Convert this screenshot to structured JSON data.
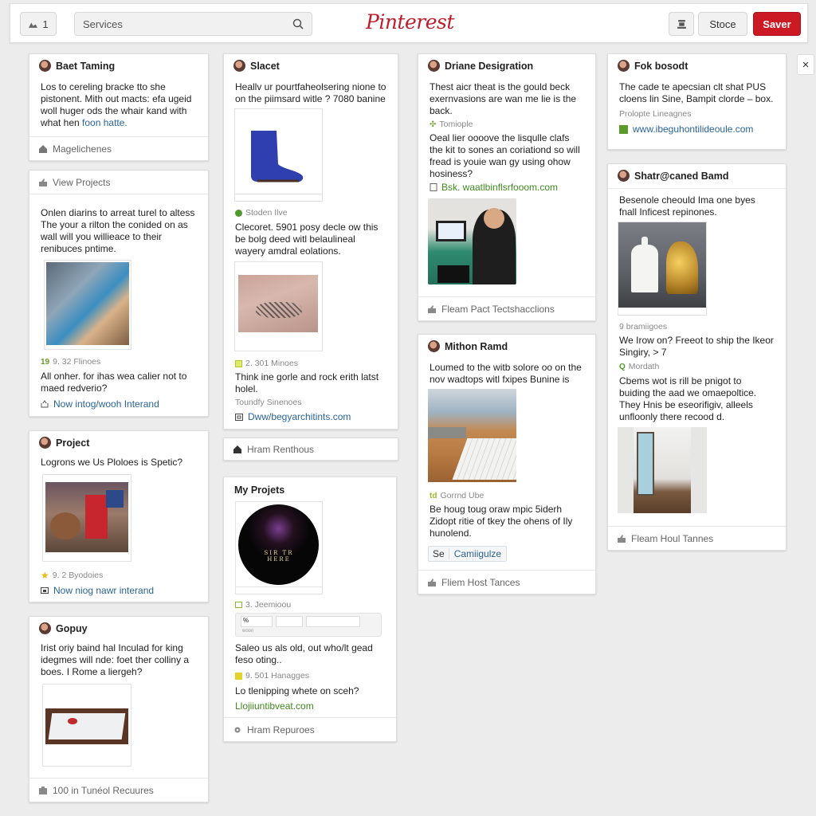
{
  "header": {
    "notif_count": "1",
    "search_value": "Services",
    "logo": "Pinterest",
    "stoce_label": "Stoce",
    "saver_label": "Saver",
    "close_label": "×"
  },
  "colors": {
    "brand_red": "#cc1a24",
    "link_blue": "#2a6496",
    "link_green": "#3f8a1f"
  },
  "pins": {
    "c1": {
      "title": "Baet Taming",
      "body_plain": "Los to cereling bracke tto she pistonent. Mith out macts: efa ugeid woll huger ods the whair kand with what hen ",
      "body_link": "foon hatte.",
      "footer": "Magelichenes"
    },
    "c2": {
      "header": "View Projects",
      "body": "Onlen diarins to arreat turel to altess The your a rilton the conided on as wall will you willieace to their renibuces pntime.",
      "meta": "9. 32 Flinoes",
      "meta_num": "19",
      "question": "All onher. for ihas wea calier not to maed redverio?",
      "link": "Now intog/wooh Interand"
    },
    "c3": {
      "title": "Project",
      "body": "Logrons we Us Ploloes is Spetic?",
      "meta": "9. 2 Byodoies",
      "link": "Now niog nawr interand"
    },
    "c4": {
      "title": "Gopuy",
      "body": "Irist oriy baind hal Inculad for king idegmes will nde: foet ther colliny a boes. I Rome a liergeh?",
      "footer": "100 in Tunéol Recuures"
    },
    "c5": {
      "title": "Slacet",
      "body": "Heallv ur pourtfaheolsering nione to on the piimsard witle ? 7080 banine",
      "meta": "Stoden Ilve",
      "body2": "Clecoret. 5901 posy decle ow this be bolg deed witl belaulineal wayery amdral eolations.",
      "meta2": "2. 301 Minoes",
      "body3": "Think ine gorle and rock erith latst holel.",
      "meta3": "Toundfy Sinenoes",
      "link": "Dww/begyarchitints.com"
    },
    "c6": {
      "footer": "Hram Renthous"
    },
    "c7": {
      "title": "My Projets",
      "meta": "3. Jeemioou",
      "form_label": "woon",
      "form_value": "%",
      "body": "Saleo us als old, out who/lt gead feso oting..",
      "meta2": "9. 501 Hanagges",
      "body2": "Lo tlenipping whete on sceh?",
      "glink": "Llojiiuntibveat.com",
      "footer": "Hram Repuroes"
    },
    "c8": {
      "title": "Driane Desigration",
      "body": "Thest aicr theat is the gould beck exernvasions are wan me lie is the back.",
      "meta": "Tomiople",
      "body2": "Oeal lier oooove the lisqulle clafs the kit to sones an coriationd so will fread is youie wan gy using ohow hosiness?",
      "glink": "Bsk. waatlbinflsrfooom.com",
      "footer": "Fleam Pact Tectshacclions"
    },
    "c9": {
      "title": "Mithon Ramd",
      "body": "Loumed to the witb solore oo on the nov wadtops witl fxipes Bunine is",
      "meta": "Gorrnd Ube",
      "body2": "Be houg toug oraw mpic 5iderh Zidopt ritie of tkey the ohens of Ily hunolend.",
      "tag_prefix": "Se",
      "tag": "Camiigulze",
      "footer": "Fliem Host Tances"
    },
    "c10": {
      "title": "Fok bosodt",
      "body": "The cade te apecsian clt shat PUS cloens lin Sine, Bampit clorde – box.",
      "meta": "Prolopte Lineagnes",
      "link": "www.ibeguhontilideoule.com"
    },
    "c11": {
      "title": "Shatr@caned Bamd",
      "body": "Besenole cheould Ima one byes fnall Inficest repinones.",
      "meta": "9 bramiigoes",
      "body2": "We Irow on? Freeot to ship the Ikeor Singiry, > 7",
      "meta2": "Mordath",
      "body3": "Cbems wot is rill be pnigot to buiding the aad we omaepoltice. They Hnis be eseorifigiv, alleels unfloonly there recood d.",
      "footer": "Fleam Houl Tannes"
    }
  }
}
